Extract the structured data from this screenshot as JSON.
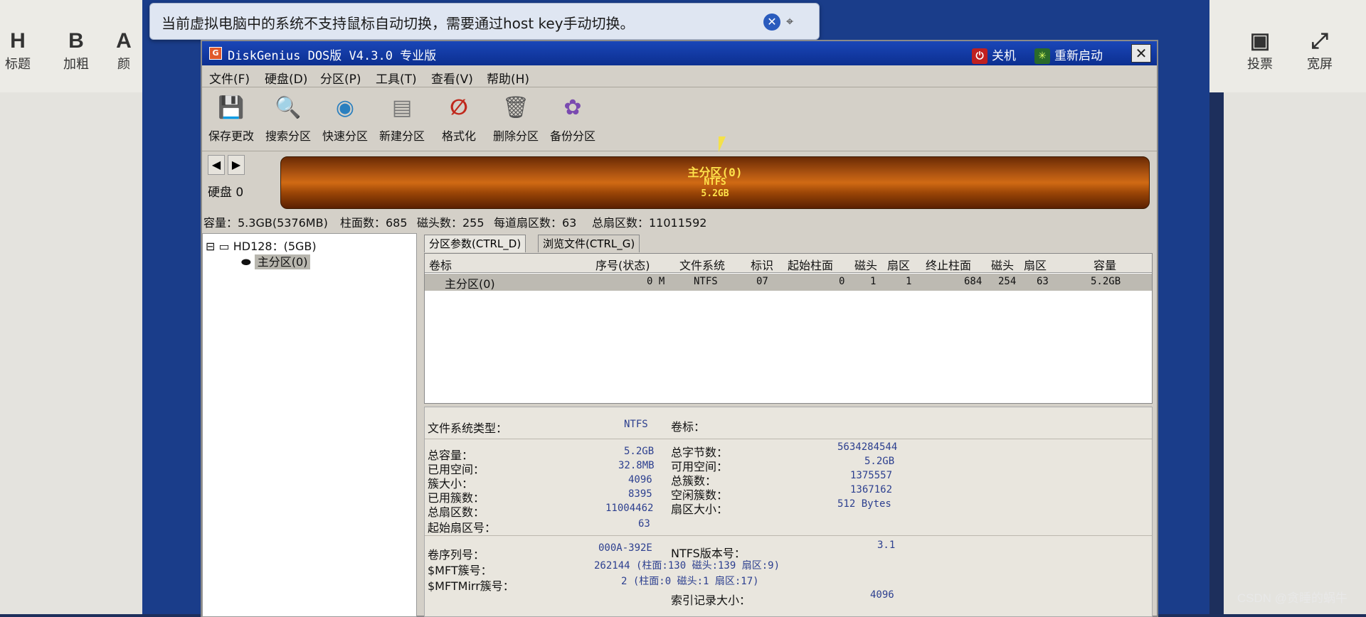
{
  "host": {
    "buttons": [
      {
        "glyph": "H",
        "label": "标题"
      },
      {
        "glyph": "B",
        "label": "加粗"
      },
      {
        "glyph": "A",
        "label": "颜"
      },
      {
        "glyph": "▣",
        "label": "投票"
      },
      {
        "glyph": "⤢",
        "label": "宽屏"
      }
    ],
    "watermark": "CSDN @贪睡的蜗牛"
  },
  "notification": {
    "text": "当前虚拟电脑中的系统不支持鼠标自动切换，需要通过host key手动切换。",
    "close_glyph": "✕",
    "pin_glyph": "⌖"
  },
  "window": {
    "icon_letter": "G",
    "title": "DiskGenius DOS版 V4.3.0 专业版",
    "shutdown_label": "关机",
    "restart_label": "重新启动",
    "close_glyph": "✕"
  },
  "menu": [
    "文件(F)",
    "硬盘(D)",
    "分区(P)",
    "工具(T)",
    "查看(V)",
    "帮助(H)"
  ],
  "toolbar": [
    {
      "icon": "save-icon",
      "glyph": "💾",
      "label": "保存更改",
      "color": "#c0392b"
    },
    {
      "icon": "search-icon",
      "glyph": "🔍",
      "label": "搜索分区",
      "color": "#555555"
    },
    {
      "icon": "quick-partition-icon",
      "glyph": "◉",
      "label": "快速分区",
      "color": "#2a7fbf"
    },
    {
      "icon": "new-partition-icon",
      "glyph": "▤",
      "label": "新建分区",
      "color": "#777777"
    },
    {
      "icon": "format-icon",
      "glyph": "∅",
      "label": "格式化",
      "color": "#c0281c"
    },
    {
      "icon": "delete-partition-icon",
      "glyph": "🗑",
      "label": "删除分区",
      "color": "#555555"
    },
    {
      "icon": "backup-partition-icon",
      "glyph": "✿",
      "label": "备份分区",
      "color": "#7a4ab0"
    }
  ],
  "disk": {
    "label": "硬盘 0",
    "partition_name": "主分区(0)",
    "partition_fs": "NTFS",
    "partition_size": "5.2GB"
  },
  "info": {
    "capacity": "容量：5.3GB(5376MB)",
    "cylinders": "柱面数：685",
    "heads": "磁头数：255",
    "sectors_per_track": "每道扇区数：63",
    "total_sectors": "总扇区数：11011592"
  },
  "tree": {
    "disk": "HD128：(5GB)",
    "partition": "主分区(0)"
  },
  "tabs": [
    "分区参数(CTRL_D)",
    "浏览文件(CTRL_G)"
  ],
  "grid": {
    "headers": [
      "卷标",
      "序号(状态)",
      "文件系统",
      "标识",
      "起始柱面",
      "磁头",
      "扇区",
      "终止柱面",
      "磁头",
      "扇区",
      "容量"
    ],
    "row": [
      "主分区(0)",
      "0 M",
      "NTFS",
      "07",
      "0",
      "1",
      "1",
      "684",
      "254",
      "63",
      "5.2GB"
    ]
  },
  "details": {
    "fs_type_label": "文件系统类型：",
    "fs_type_value": "NTFS",
    "volume_label_label": "卷标：",
    "left": [
      {
        "label": "总容量：",
        "value": "5.2GB"
      },
      {
        "label": "已用空间：",
        "value": "32.8MB"
      },
      {
        "label": "簇大小：",
        "value": "4096"
      },
      {
        "label": "已用簇数：",
        "value": "8395"
      },
      {
        "label": "总扇区数：",
        "value": "11004462"
      },
      {
        "label": "起始扇区号：",
        "value": "63"
      }
    ],
    "right": [
      {
        "label": "总字节数：",
        "value": "5634284544"
      },
      {
        "label": "可用空间：",
        "value": "5.2GB"
      },
      {
        "label": "总簇数：",
        "value": "1375557"
      },
      {
        "label": "空闲簇数：",
        "value": "1367162"
      },
      {
        "label": "扇区大小：",
        "value": "512 Bytes"
      }
    ],
    "bottom_left": [
      {
        "label": "卷序列号：",
        "value": "000A-392E"
      },
      {
        "label": "$MFT簇号：",
        "value": "262144 (柱面:130 磁头:139 扇区:9)"
      },
      {
        "label": "$MFTMirr簇号：",
        "value": "2 (柱面:0 磁头:1 扇区:17)"
      }
    ],
    "bottom_right": [
      {
        "label": "NTFS版本号：",
        "value": "3.1"
      },
      {
        "label": "索引记录大小：",
        "value": "4096"
      }
    ]
  }
}
